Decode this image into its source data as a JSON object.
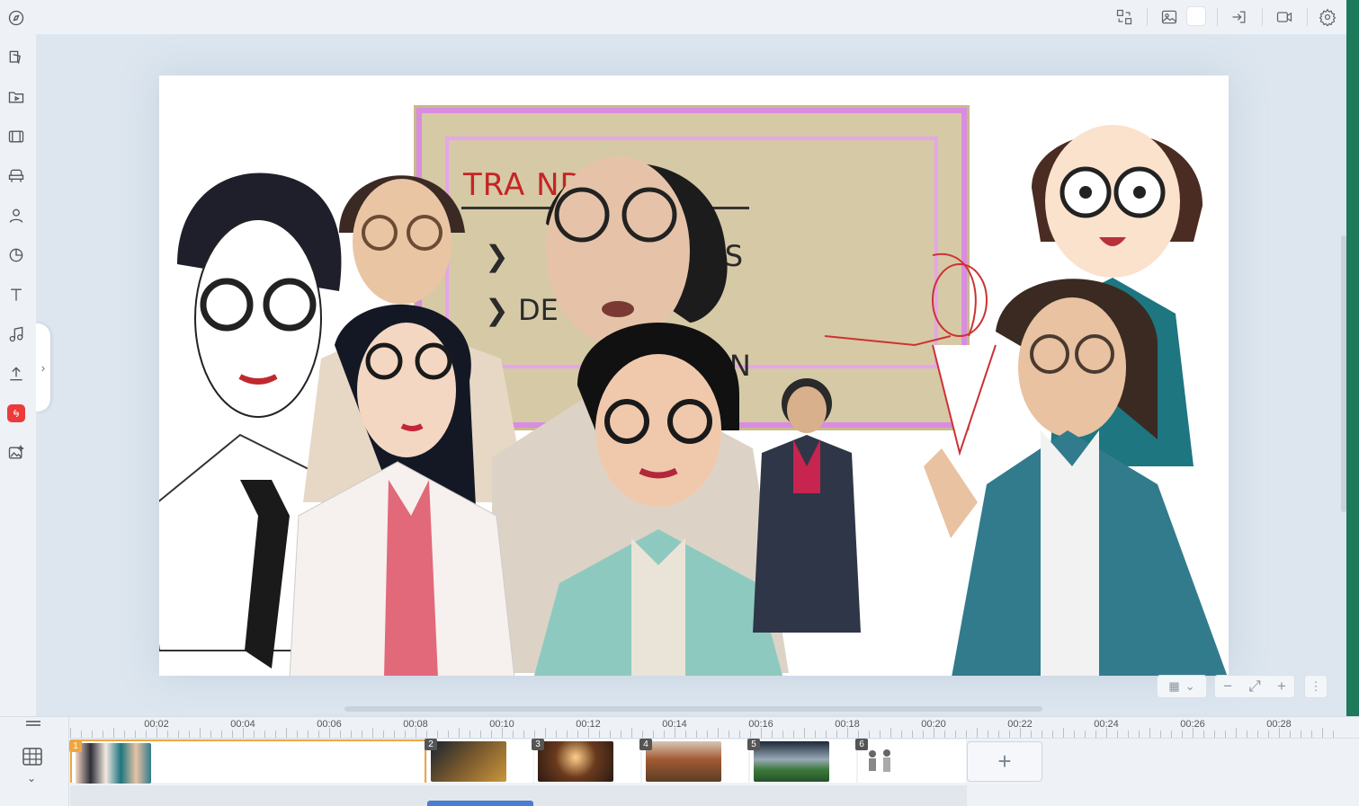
{
  "board": {
    "title": "TRA      NDA",
    "row1": "ALS",
    "row2": "DE           S",
    "row3": "AN"
  },
  "timeline": {
    "ticks": [
      "00:02",
      "00:04",
      "00:06",
      "00:08",
      "00:10",
      "00:12",
      "00:14",
      "00:16",
      "00:18",
      "00:20",
      "00:22",
      "00:24",
      "00:26",
      "00:28"
    ],
    "scenes": [
      {
        "num": "1",
        "active": true
      },
      {
        "num": "2",
        "active": false
      },
      {
        "num": "3",
        "active": false
      },
      {
        "num": "4",
        "active": false
      },
      {
        "num": "5",
        "active": false
      },
      {
        "num": "6",
        "active": false
      }
    ],
    "add_label": "+"
  },
  "zoom": {
    "minus": "−",
    "plus": "+"
  },
  "colors": {
    "accent": "#f0a640",
    "brand": "#1d7a5a",
    "alert": "#ec3b3b"
  }
}
